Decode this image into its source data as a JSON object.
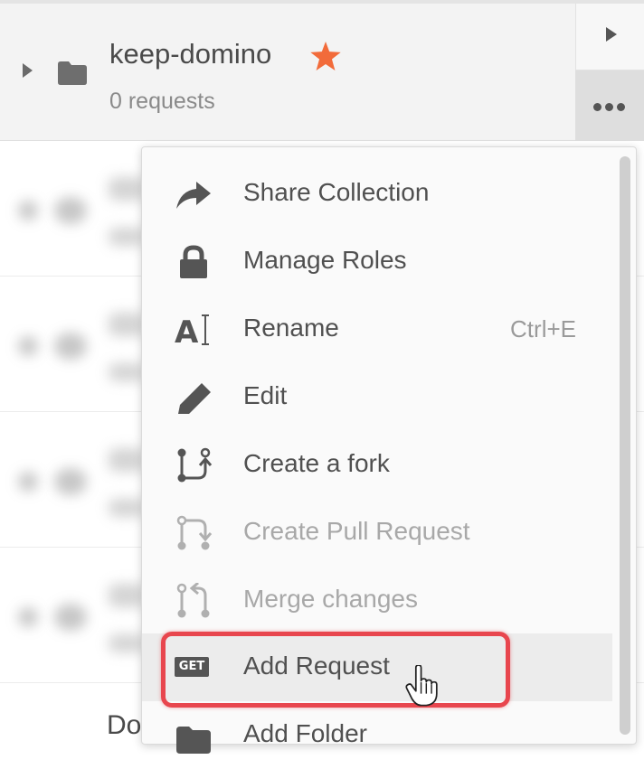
{
  "collection": {
    "name": "keep-domino",
    "request_count": "0 requests",
    "starred": true,
    "star_color": "#f26b3a"
  },
  "menu": {
    "items": [
      {
        "label": "Share Collection",
        "icon": "share-arrow-icon",
        "shortcut": "",
        "disabled": false
      },
      {
        "label": "Manage Roles",
        "icon": "lock-icon",
        "shortcut": "",
        "disabled": false
      },
      {
        "label": "Rename",
        "icon": "rename-icon",
        "shortcut": "Ctrl+E",
        "disabled": false
      },
      {
        "label": "Edit",
        "icon": "pencil-icon",
        "shortcut": "",
        "disabled": false
      },
      {
        "label": "Create a fork",
        "icon": "fork-icon",
        "shortcut": "",
        "disabled": false
      },
      {
        "label": "Create Pull Request",
        "icon": "pull-request-icon",
        "shortcut": "",
        "disabled": true
      },
      {
        "label": "Merge changes",
        "icon": "merge-icon",
        "shortcut": "",
        "disabled": true
      },
      {
        "label": "Add Request",
        "icon": "get-request-icon",
        "badge": "GET",
        "shortcut": "",
        "disabled": false,
        "hovered": true
      },
      {
        "label": "Add Folder",
        "icon": "folder-icon",
        "shortcut": "",
        "disabled": false
      }
    ],
    "highlight_color": "#e8464e"
  },
  "background": {
    "partial_text": "Do"
  }
}
